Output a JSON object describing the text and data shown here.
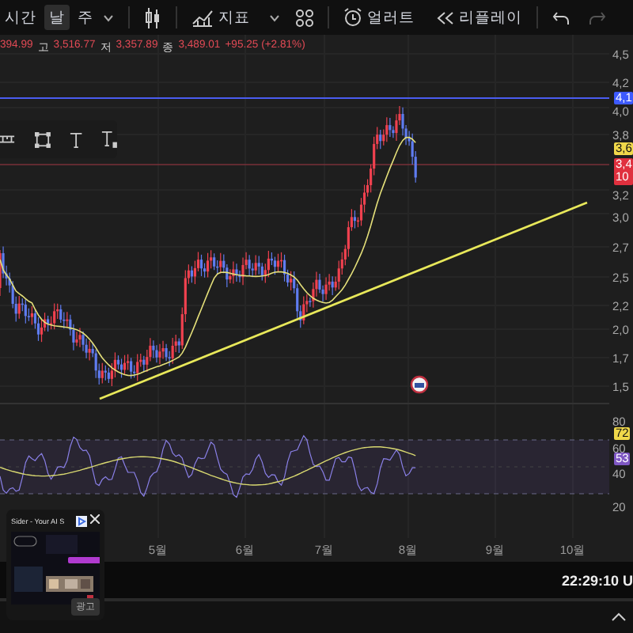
{
  "toolbar": {
    "timeframes": [
      {
        "label": "시간",
        "selected": false
      },
      {
        "label": "날",
        "selected": true
      },
      {
        "label": "주",
        "selected": false
      }
    ],
    "indicators": "지표",
    "alert": "얼러트",
    "replay": "리플레이"
  },
  "legend": {
    "open_value": "394.99",
    "high_label": "고",
    "high_value": "3,516.77",
    "low_label": "저",
    "low_value": "3,357.89",
    "close_label": "종",
    "close_value": "3,489.01",
    "change": "+95.25 (+2.81%)"
  },
  "price_axis": [
    {
      "kind": "tick",
      "label": "4,5"
    },
    {
      "kind": "tick",
      "label": "4,2"
    },
    {
      "kind": "badge",
      "label": "4,1",
      "color": "#3d5afe"
    },
    {
      "kind": "tick",
      "label": "4,0"
    },
    {
      "kind": "tick",
      "label": "3,8"
    },
    {
      "kind": "badge",
      "label": "3,6",
      "color": "#f0d84a"
    },
    {
      "kind": "badge",
      "label": "3,4",
      "sublabel": "10",
      "color": "#e0303e"
    },
    {
      "kind": "tick",
      "label": "3,2"
    },
    {
      "kind": "tick",
      "label": "3,0"
    },
    {
      "kind": "tick",
      "label": "2,7"
    },
    {
      "kind": "tick",
      "label": "2,5"
    },
    {
      "kind": "tick",
      "label": "2,2"
    },
    {
      "kind": "tick",
      "label": "2,0"
    },
    {
      "kind": "tick",
      "label": "1,7"
    },
    {
      "kind": "tick",
      "label": "1,5"
    },
    {
      "kind": "tick",
      "label": "80"
    },
    {
      "kind": "badge",
      "label": "72",
      "color": "#f0d84a"
    },
    {
      "kind": "tick",
      "label": "60"
    },
    {
      "kind": "badge",
      "label": "53",
      "color": "#7e57c2"
    },
    {
      "kind": "tick",
      "label": "40"
    },
    {
      "kind": "tick",
      "label": "20"
    }
  ],
  "time_axis": [
    "5월",
    "6월",
    "7월",
    "8월",
    "9월",
    "10월"
  ],
  "popup": {
    "title": "Sider - Your AI S",
    "ad_button": "광고"
  },
  "status_bar": {
    "time": "22:29:10 U"
  }
}
